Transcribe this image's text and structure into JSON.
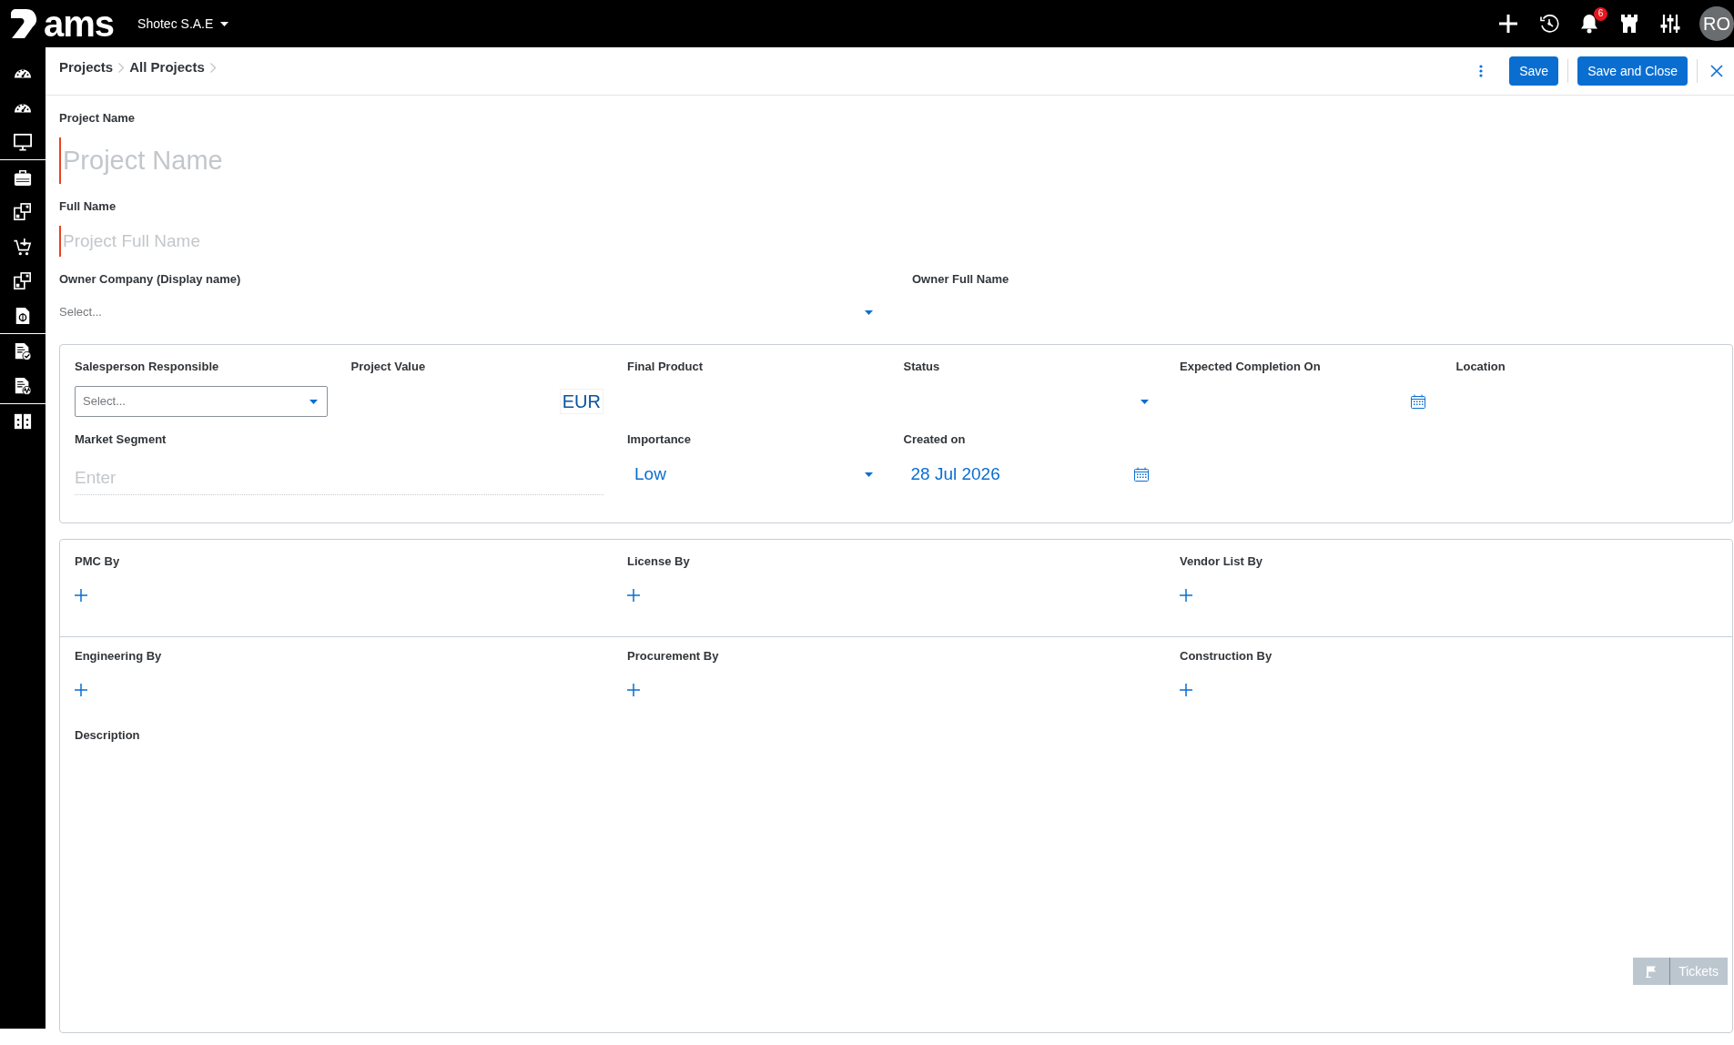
{
  "top_bar": {
    "logo_text": "ams",
    "company": "Shotec S.A.E",
    "notifications": "6",
    "avatar": "RO"
  },
  "breadcrumb": [
    {
      "label": "Projects"
    },
    {
      "label": "All Projects"
    }
  ],
  "actions": [
    {
      "label": "Save"
    },
    {
      "label": "Save and Close"
    }
  ],
  "form": {
    "fields": [
      {
        "kind": "title",
        "label": "Project Name",
        "placeholder": "Project Name",
        "required": true
      },
      {
        "kind": "subtitle",
        "label": "Full Name",
        "placeholder": "Project Full Name",
        "required": true
      }
    ],
    "owner_fields": [
      {
        "kind": "select",
        "label": "Owner Company (Display name)",
        "placeholder": "Select..."
      },
      {
        "kind": "text",
        "label": "Owner Full Name"
      }
    ]
  },
  "details": {
    "rows": [
      [
        {
          "kind": "boxed_select",
          "label": "Salesperson Responsible",
          "placeholder": "Select..."
        },
        {
          "kind": "currency",
          "label": "Project Value",
          "currency": "EUR"
        },
        {
          "kind": "text",
          "label": "Final Product"
        },
        {
          "kind": "select",
          "label": "Status"
        },
        {
          "kind": "date",
          "label": "Expected Completion On"
        },
        {
          "kind": "text",
          "label": "Location"
        }
      ],
      [
        {
          "kind": "wide_input",
          "label": "Market Segment",
          "placeholder": "Enter"
        },
        "",
        {
          "kind": "select",
          "label": "Importance",
          "value": "Low"
        },
        {
          "kind": "date",
          "label": "Created on",
          "value": "28 Jul 2026"
        }
      ]
    ]
  },
  "parties": {
    "rows": [
      [
        {
          "label": "PMC By"
        },
        {
          "label": "License By"
        },
        {
          "label": "Vendor List By"
        }
      ],
      [
        {
          "label": "Engineering By"
        },
        {
          "label": "Procurement By"
        },
        {
          "label": "Construction By"
        }
      ]
    ]
  },
  "description": {
    "label": "Description"
  },
  "tickets": {
    "label": "Tickets"
  }
}
